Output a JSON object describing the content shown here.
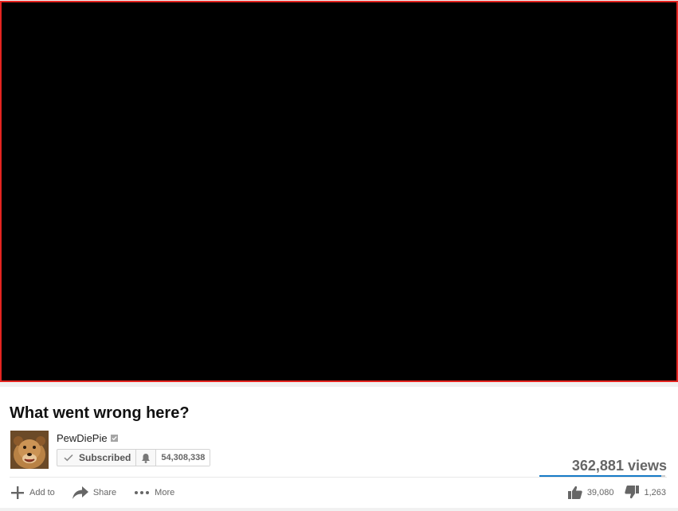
{
  "video": {
    "title": "What went wrong here?"
  },
  "channel": {
    "name": "PewDiePie",
    "verified": true,
    "subscribe_label": "Subscribed",
    "subscriber_count": "54,308,338"
  },
  "stats": {
    "views": "362,881 views",
    "likes": "39,080",
    "dislikes": "1,263",
    "like_ratio": 0.969
  },
  "actions": {
    "add_to": "Add to",
    "share": "Share",
    "more": "More"
  },
  "colors": {
    "player_border": "#e52420",
    "like_bar_fill": "#167ac6",
    "icon_grey": "#666666"
  }
}
